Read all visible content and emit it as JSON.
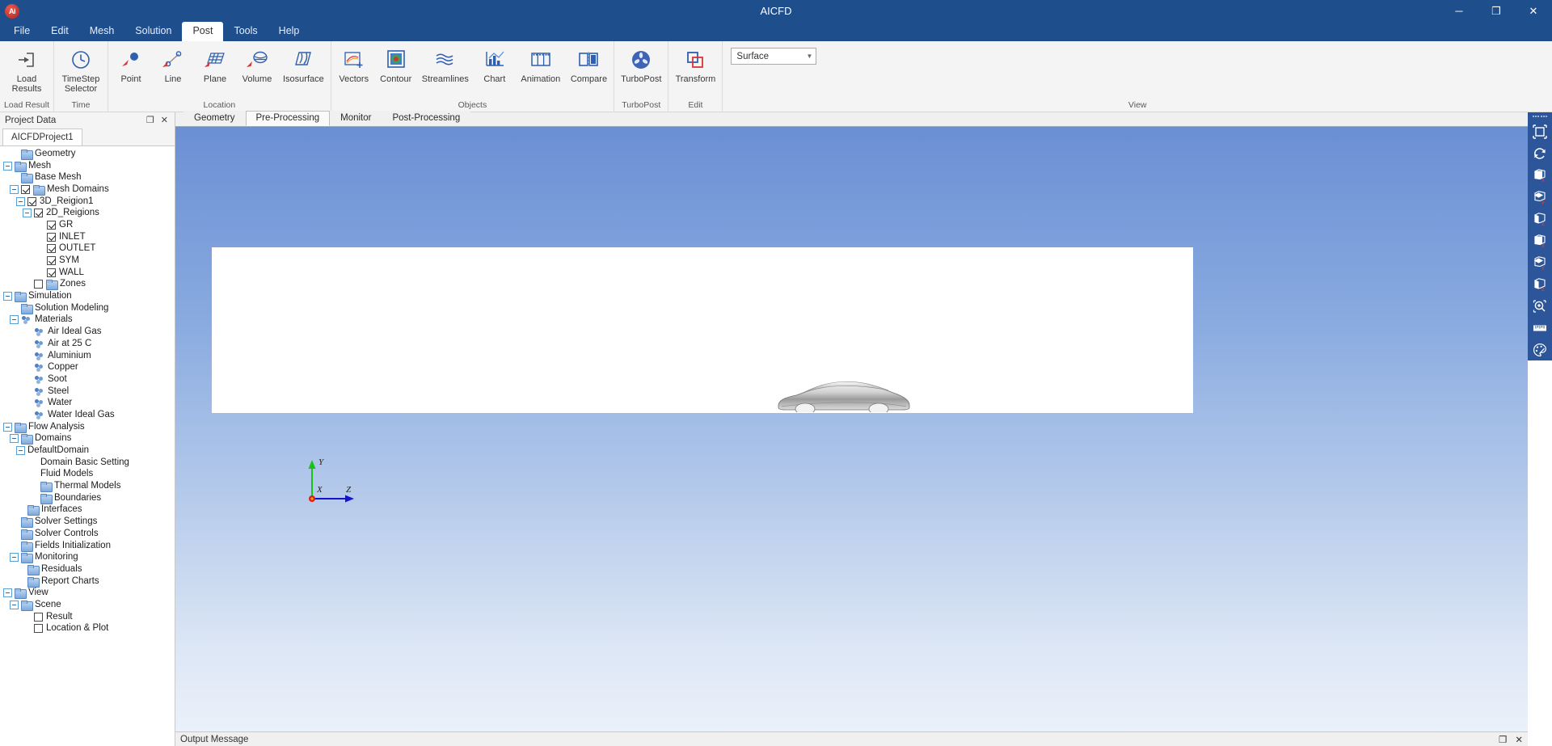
{
  "window": {
    "title": "AICFD",
    "logo_text": "Ai",
    "minimize": "─",
    "maximize": "❐",
    "close": "✕"
  },
  "menubar": {
    "items": [
      {
        "label": "File",
        "active": false
      },
      {
        "label": "Edit",
        "active": false
      },
      {
        "label": "Mesh",
        "active": false
      },
      {
        "label": "Solution",
        "active": false
      },
      {
        "label": "Post",
        "active": true
      },
      {
        "label": "Tools",
        "active": false
      },
      {
        "label": "Help",
        "active": false
      }
    ]
  },
  "ribbon": {
    "groups": [
      {
        "title": "Load Result",
        "buttons": [
          {
            "label": "Load\nResults",
            "icon": "load-results-icon"
          }
        ]
      },
      {
        "title": "Time",
        "buttons": [
          {
            "label": "TimeStep\nSelector",
            "icon": "clock-icon"
          }
        ]
      },
      {
        "title": "Location",
        "buttons": [
          {
            "label": "Point",
            "icon": "point-icon"
          },
          {
            "label": "Line",
            "icon": "line-icon"
          },
          {
            "label": "Plane",
            "icon": "plane-icon"
          },
          {
            "label": "Volume",
            "icon": "volume-icon"
          },
          {
            "label": "Isosurface",
            "icon": "isosurface-icon"
          }
        ]
      },
      {
        "title": "Objects",
        "buttons": [
          {
            "label": "Vectors",
            "icon": "vectors-icon"
          },
          {
            "label": "Contour",
            "icon": "contour-icon"
          },
          {
            "label": "Streamlines",
            "icon": "streamlines-icon"
          },
          {
            "label": "Chart",
            "icon": "chart-icon"
          },
          {
            "label": "Animation",
            "icon": "animation-icon"
          },
          {
            "label": "Compare",
            "icon": "compare-icon"
          }
        ]
      },
      {
        "title": "TurboPost",
        "buttons": [
          {
            "label": "TurboPost",
            "icon": "turbopost-fan-icon"
          }
        ]
      },
      {
        "title": "Edit",
        "buttons": [
          {
            "label": "Transform",
            "icon": "transform-icon"
          }
        ]
      },
      {
        "title": "View",
        "buttons": []
      }
    ],
    "view_combo": {
      "value": "Surface",
      "caret": "▼"
    }
  },
  "project_panel": {
    "title": "Project Data",
    "restore_icon": "❐",
    "close_icon": "✕",
    "tab": "AICFDProject1",
    "tree": [
      {
        "label": "Geometry",
        "indent": 1,
        "exp": "none",
        "check": "none",
        "icon": "folder"
      },
      {
        "label": "Mesh",
        "indent": 0,
        "exp": "minus",
        "check": "none",
        "icon": "folder"
      },
      {
        "label": "Base Mesh",
        "indent": 1,
        "exp": "none",
        "check": "none",
        "icon": "folder"
      },
      {
        "label": "Mesh Domains",
        "indent": 1,
        "exp": "minus",
        "check": "on",
        "icon": "folder"
      },
      {
        "label": "3D_Reigion1",
        "indent": 2,
        "exp": "minus",
        "check": "on",
        "icon": "none"
      },
      {
        "label": "2D_Reigions",
        "indent": 3,
        "exp": "minus",
        "check": "on",
        "icon": "none"
      },
      {
        "label": "GR",
        "indent": 5,
        "exp": "none",
        "check": "on",
        "icon": "none"
      },
      {
        "label": "INLET",
        "indent": 5,
        "exp": "none",
        "check": "on",
        "icon": "none"
      },
      {
        "label": "OUTLET",
        "indent": 5,
        "exp": "none",
        "check": "on",
        "icon": "none"
      },
      {
        "label": "SYM",
        "indent": 5,
        "exp": "none",
        "check": "on",
        "icon": "none"
      },
      {
        "label": "WALL",
        "indent": 5,
        "exp": "none",
        "check": "on",
        "icon": "none"
      },
      {
        "label": "Zones",
        "indent": 3,
        "exp": "none",
        "check": "off",
        "icon": "folder"
      },
      {
        "label": "Simulation",
        "indent": 0,
        "exp": "minus",
        "check": "none",
        "icon": "folder"
      },
      {
        "label": "Solution Modeling",
        "indent": 1,
        "exp": "none",
        "check": "none",
        "icon": "folder"
      },
      {
        "label": "Materials",
        "indent": 1,
        "exp": "minus",
        "check": "none",
        "icon": "material"
      },
      {
        "label": "Air Ideal Gas",
        "indent": 3,
        "exp": "none",
        "check": "none",
        "icon": "material"
      },
      {
        "label": "Air at 25 C",
        "indent": 3,
        "exp": "none",
        "check": "none",
        "icon": "material"
      },
      {
        "label": "Aluminium",
        "indent": 3,
        "exp": "none",
        "check": "none",
        "icon": "material"
      },
      {
        "label": "Copper",
        "indent": 3,
        "exp": "none",
        "check": "none",
        "icon": "material"
      },
      {
        "label": "Soot",
        "indent": 3,
        "exp": "none",
        "check": "none",
        "icon": "material"
      },
      {
        "label": "Steel",
        "indent": 3,
        "exp": "none",
        "check": "none",
        "icon": "material"
      },
      {
        "label": "Water",
        "indent": 3,
        "exp": "none",
        "check": "none",
        "icon": "material"
      },
      {
        "label": "Water Ideal Gas",
        "indent": 3,
        "exp": "none",
        "check": "none",
        "icon": "material"
      },
      {
        "label": "Flow Analysis",
        "indent": 0,
        "exp": "minus",
        "check": "none",
        "icon": "folder"
      },
      {
        "label": "Domains",
        "indent": 1,
        "exp": "minus",
        "check": "none",
        "icon": "folder"
      },
      {
        "label": "DefaultDomain",
        "indent": 2,
        "exp": "minus",
        "check": "none",
        "icon": "none"
      },
      {
        "label": "Domain Basic Setting",
        "indent": 4,
        "exp": "none",
        "check": "none",
        "icon": "none"
      },
      {
        "label": "Fluid Models",
        "indent": 4,
        "exp": "none",
        "check": "none",
        "icon": "none"
      },
      {
        "label": "Thermal Models",
        "indent": 4,
        "exp": "none",
        "check": "none",
        "icon": "folder"
      },
      {
        "label": "Boundaries",
        "indent": 4,
        "exp": "none",
        "check": "none",
        "icon": "folder"
      },
      {
        "label": "Interfaces",
        "indent": 2,
        "exp": "none",
        "check": "none",
        "icon": "folder"
      },
      {
        "label": "Solver Settings",
        "indent": 1,
        "exp": "none",
        "check": "none",
        "icon": "folder"
      },
      {
        "label": "Solver Controls",
        "indent": 1,
        "exp": "none",
        "check": "none",
        "icon": "folder"
      },
      {
        "label": "Fields Initialization",
        "indent": 1,
        "exp": "none",
        "check": "none",
        "icon": "folder"
      },
      {
        "label": "Monitoring",
        "indent": 1,
        "exp": "minus",
        "check": "none",
        "icon": "folder"
      },
      {
        "label": "Residuals",
        "indent": 2,
        "exp": "none",
        "check": "none",
        "icon": "folder"
      },
      {
        "label": "Report Charts",
        "indent": 2,
        "exp": "none",
        "check": "none",
        "icon": "folder"
      },
      {
        "label": "View",
        "indent": 0,
        "exp": "minus",
        "check": "none",
        "icon": "folder"
      },
      {
        "label": "Scene",
        "indent": 1,
        "exp": "minus",
        "check": "none",
        "icon": "folder"
      },
      {
        "label": "Result",
        "indent": 3,
        "exp": "none",
        "check": "off",
        "icon": "none"
      },
      {
        "label": "Location & Plot",
        "indent": 3,
        "exp": "none",
        "check": "off",
        "icon": "none"
      }
    ]
  },
  "viewport": {
    "tabs": [
      {
        "label": "Geometry",
        "active": false
      },
      {
        "label": "Pre-Processing",
        "active": true
      },
      {
        "label": "Monitor",
        "active": false
      },
      {
        "label": "Post-Processing",
        "active": false
      }
    ],
    "axis": {
      "x": "X",
      "y": "Y",
      "z": "Z"
    },
    "colors": {
      "axis_x": "#e01b1b",
      "axis_y": "#19c219",
      "axis_z": "#1414d0",
      "sky_top": "#6b8fd4",
      "sky_bottom": "#eef3fb",
      "ground": "#ffffff"
    }
  },
  "status": {
    "output_message": "Output Message",
    "restore_icon": "❐",
    "close_icon": "✕"
  },
  "right_toolbar": {
    "buttons": [
      {
        "name": "fit-to-view-icon",
        "title": "Fit to view"
      },
      {
        "name": "reset-rotate-icon",
        "title": "Reset view"
      },
      {
        "name": "view-pos-x-icon",
        "title": "+X view"
      },
      {
        "name": "view-pos-y-icon",
        "title": "+Y view"
      },
      {
        "name": "view-pos-z-icon",
        "title": "+Z view"
      },
      {
        "name": "view-neg-x-icon",
        "title": "-X view"
      },
      {
        "name": "view-neg-y-icon",
        "title": "-Y view"
      },
      {
        "name": "view-neg-z-icon",
        "title": "-Z view"
      },
      {
        "name": "zoom-box-icon",
        "title": "Zoom"
      },
      {
        "name": "ruler-measure-icon",
        "title": "Measure"
      },
      {
        "name": "color-palette-icon",
        "title": "Appearance"
      }
    ]
  }
}
